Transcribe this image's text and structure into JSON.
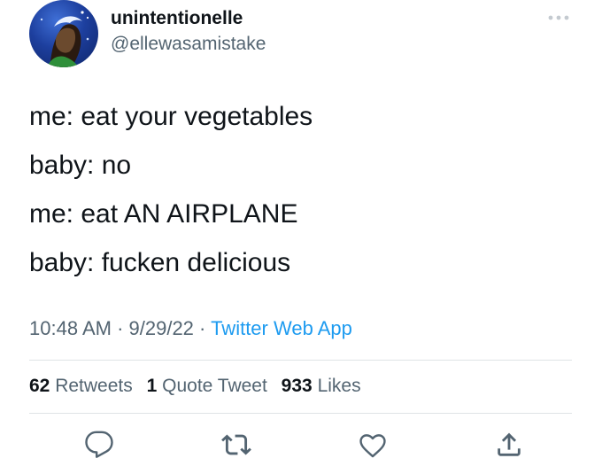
{
  "user": {
    "name": "unintentionelle",
    "handle": "@ellewasamistake"
  },
  "more_icon": "more-horizontal-icon",
  "tweet": {
    "lines": [
      "me: eat your vegetables",
      "baby: no",
      "me: eat AN AIRPLANE",
      "baby: fucken delicious"
    ]
  },
  "meta": {
    "time": "10:48 AM",
    "sep1": " · ",
    "date": "9/29/22",
    "sep2": " · ",
    "source": "Twitter Web App"
  },
  "stats": {
    "retweets_count": "62",
    "retweets_label": "Retweets",
    "quotes_count": "1",
    "quotes_label": "Quote Tweet",
    "likes_count": "933",
    "likes_label": "Likes"
  },
  "actions": {
    "icons": [
      "reply-icon",
      "retweet-icon",
      "like-icon",
      "share-icon"
    ]
  },
  "colors": {
    "text": "#0f1419",
    "secondary": "#536471",
    "link": "#1d9bf0",
    "divider": "#dfe3e6"
  }
}
